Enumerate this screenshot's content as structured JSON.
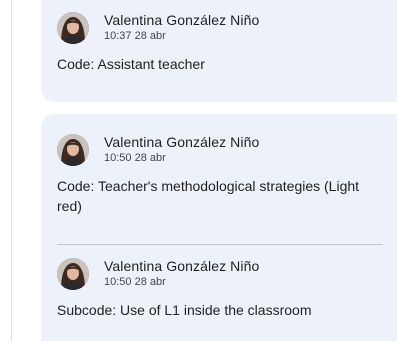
{
  "comments": [
    {
      "author": "Valentina González Niño",
      "timestamp": "10:37 28 abr",
      "text": "Code: Assistant teacher"
    },
    {
      "author": "Valentina González Niño",
      "timestamp": "10:50 28 abr",
      "text": "Code: Teacher's methodological strategies (Light red)"
    },
    {
      "author": "Valentina González Niño",
      "timestamp": "10:50 28 abr",
      "text": "Subcode: Use of L1 inside the classroom"
    }
  ],
  "colors": {
    "card_background": "#edf2fa",
    "text_primary": "#1f1f1f",
    "text_secondary": "#444746",
    "divider": "#c7c7c7"
  },
  "icons": {
    "avatar": "user-photo-avatar"
  }
}
